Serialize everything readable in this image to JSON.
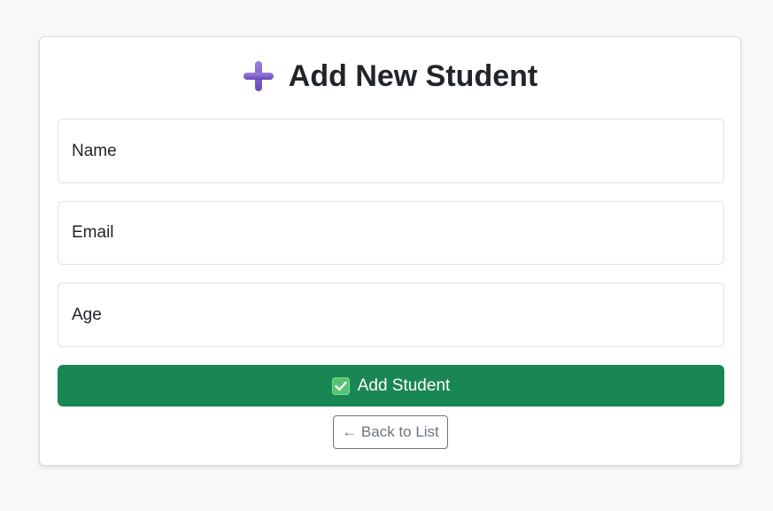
{
  "header": {
    "title": "Add New Student",
    "icon": "heavy-plus-icon",
    "icon_color": "#7b5cc9"
  },
  "form": {
    "name_placeholder": "Name",
    "email_placeholder": "Email",
    "age_placeholder": "Age",
    "submit_label": "Add Student",
    "submit_icon": "check-mark-box-icon",
    "submit_color": "#198754",
    "back_label": "← Back to List"
  }
}
